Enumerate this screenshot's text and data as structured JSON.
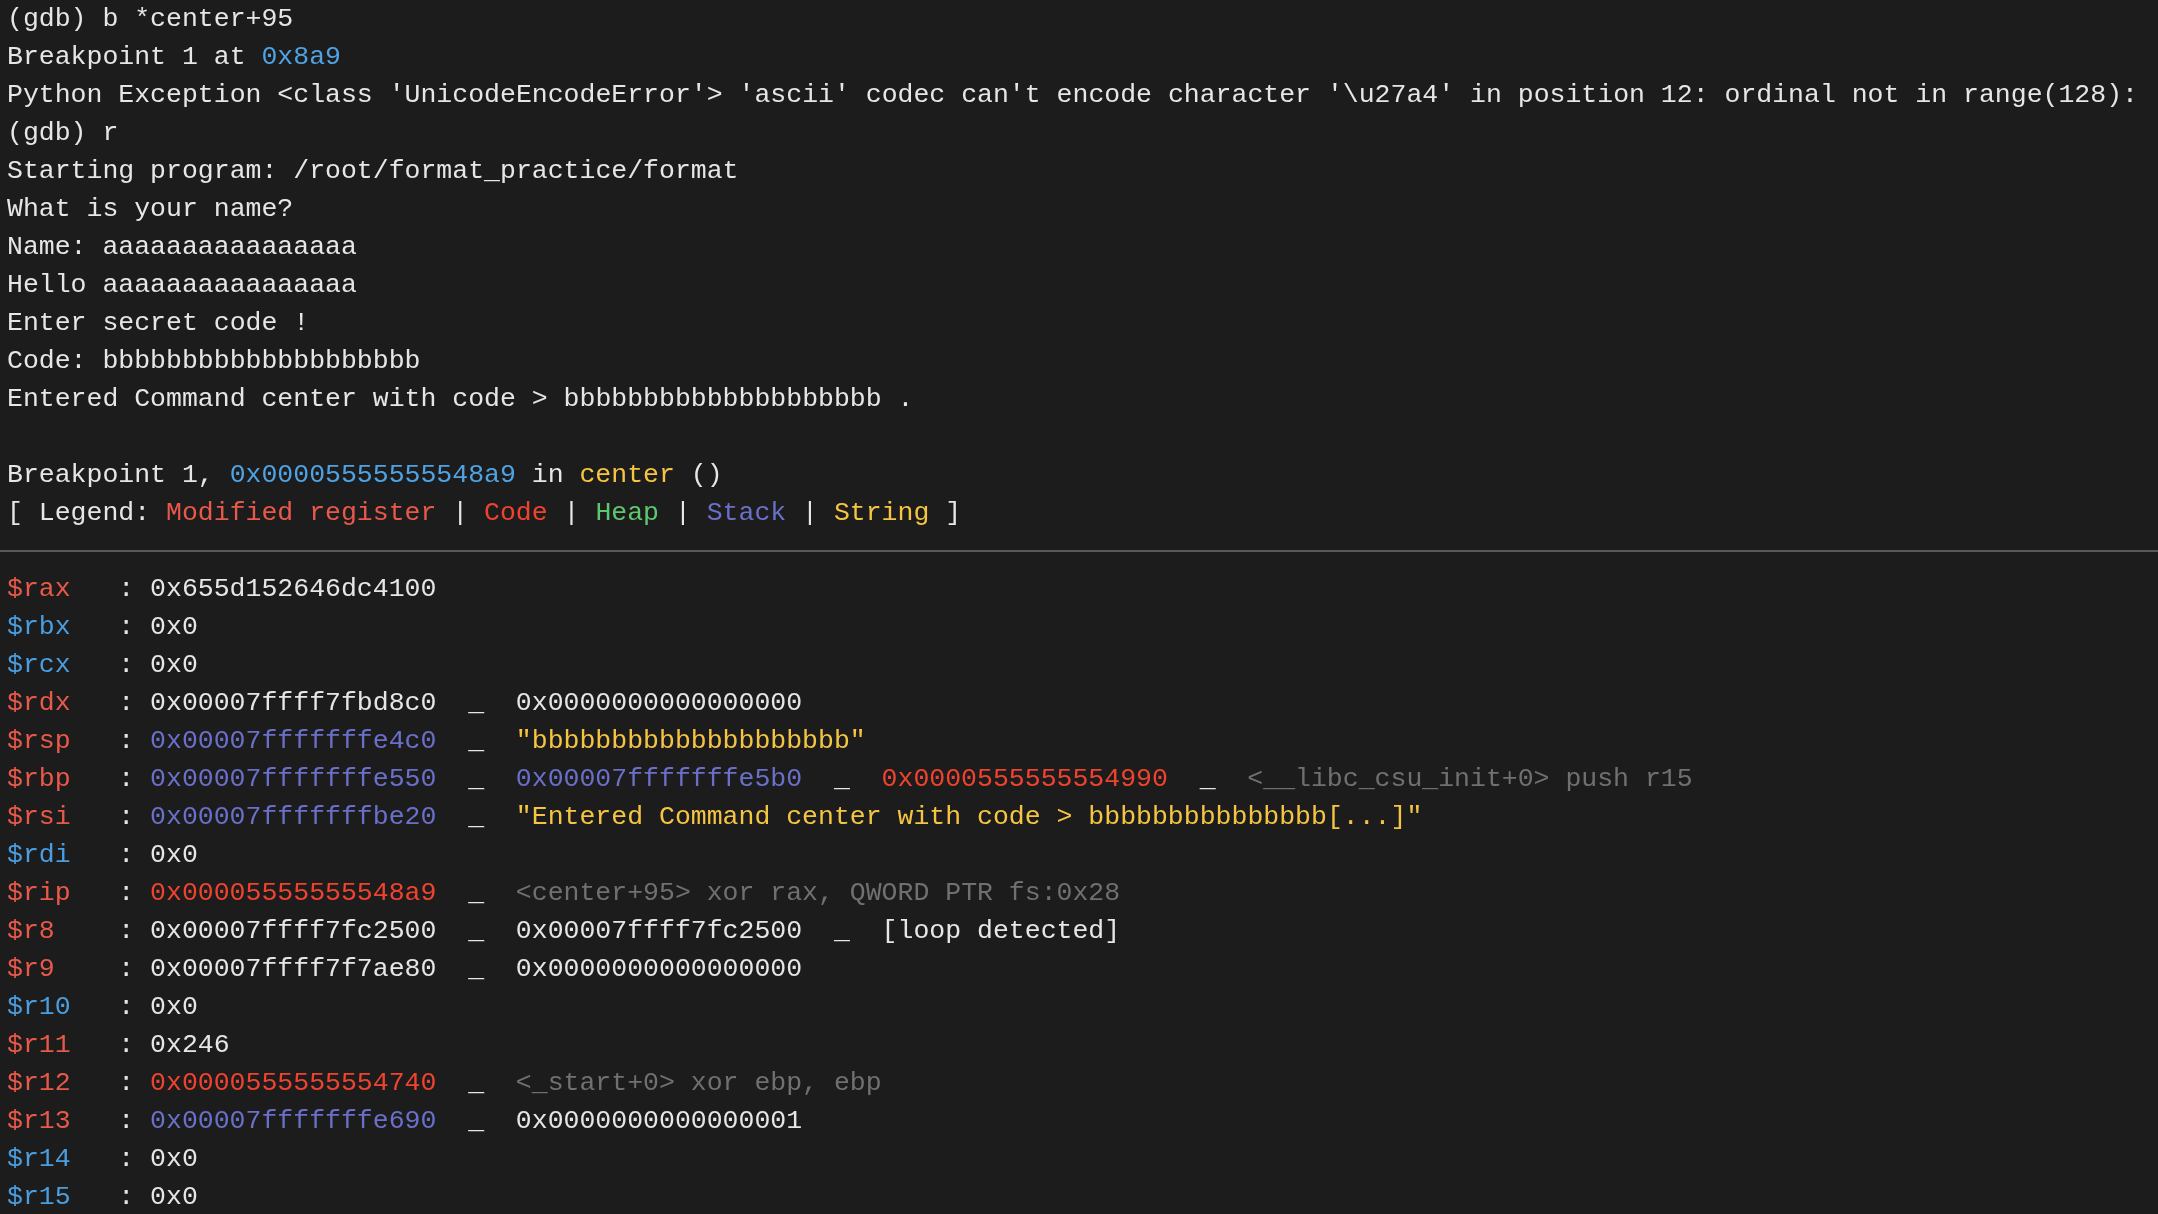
{
  "console": [
    [
      {
        "text": "(gdb) b *center+95",
        "kind": "plain"
      }
    ],
    [
      {
        "text": "Breakpoint 1 at",
        "kind": "plain"
      },
      {
        "text": "0x8a9",
        "kind": "address"
      }
    ],
    [
      {
        "text": "Python Exception <class 'UnicodeEncodeError'> 'ascii' codec can't encode character '\\u27a4' in position 12: ordinal not in range(128):",
        "kind": "plain"
      }
    ],
    [
      {
        "text": "(gdb) r",
        "kind": "plain"
      }
    ],
    [
      {
        "text": "Starting program: /root/format_practice/format",
        "kind": "plain"
      }
    ],
    [
      {
        "text": "What is your name?",
        "kind": "plain"
      }
    ],
    [
      {
        "text": "Name: aaaaaaaaaaaaaaaa",
        "kind": "plain"
      }
    ],
    [
      {
        "text": "Hello aaaaaaaaaaaaaaaa",
        "kind": "plain"
      }
    ],
    [
      {
        "text": "Enter secret code !",
        "kind": "plain"
      }
    ],
    [
      {
        "text": "Code: bbbbbbbbbbbbbbbbbbbb",
        "kind": "plain"
      }
    ],
    [
      {
        "text": "Entered Command center with code > bbbbbbbbbbbbbbbbbbbb .",
        "kind": "plain"
      }
    ]
  ],
  "breakpoint_report": [
    [
      {
        "text": "Breakpoint 1,",
        "kind": "plain"
      },
      {
        "text": "0x00005555555548a9",
        "kind": "address"
      },
      {
        "text": "in",
        "kind": "plain"
      },
      {
        "text": "center",
        "kind": "symbol"
      },
      {
        "text": "()",
        "kind": "plain"
      }
    ],
    [
      {
        "text": "[ Legend:",
        "kind": "plain"
      },
      {
        "text": "Modified register",
        "kind": "modified"
      },
      {
        "text": "|",
        "kind": "plain"
      },
      {
        "text": "Code",
        "kind": "code"
      },
      {
        "text": "|",
        "kind": "plain"
      },
      {
        "text": "Heap",
        "kind": "heap"
      },
      {
        "text": "|",
        "kind": "plain"
      },
      {
        "text": "Stack",
        "kind": "stack"
      },
      {
        "text": "|",
        "kind": "plain"
      },
      {
        "text": "String",
        "kind": "string"
      },
      {
        "text": "]",
        "kind": "plain"
      }
    ]
  ],
  "registers": [
    {
      "name": "$rax",
      "modified": true,
      "separator": ":",
      "chain": [
        {
          "text": "0x655d152646dc4100",
          "kind": "plain"
        }
      ]
    },
    {
      "name": "$rbx",
      "modified": false,
      "separator": ":",
      "chain": [
        {
          "text": "0x0",
          "kind": "plain"
        }
      ]
    },
    {
      "name": "$rcx",
      "modified": false,
      "separator": ":",
      "chain": [
        {
          "text": "0x0",
          "kind": "plain"
        }
      ]
    },
    {
      "name": "$rdx",
      "modified": true,
      "separator": ":",
      "chain": [
        {
          "text": "0x00007ffff7fbd8c0",
          "kind": "plain"
        },
        {
          "text": "_",
          "kind": "arrow"
        },
        {
          "text": "0x0000000000000000",
          "kind": "plain"
        }
      ]
    },
    {
      "name": "$rsp",
      "modified": true,
      "separator": ":",
      "chain": [
        {
          "text": "0x00007fffffffe4c0",
          "kind": "stack"
        },
        {
          "text": "_",
          "kind": "arrow"
        },
        {
          "text": "\"bbbbbbbbbbbbbbbbbbbb\"",
          "kind": "string"
        }
      ]
    },
    {
      "name": "$rbp",
      "modified": true,
      "separator": ":",
      "chain": [
        {
          "text": "0x00007fffffffe550",
          "kind": "stack"
        },
        {
          "text": "_",
          "kind": "arrow"
        },
        {
          "text": "0x00007fffffffe5b0",
          "kind": "stack"
        },
        {
          "text": "_",
          "kind": "arrow"
        },
        {
          "text": "0x0000555555554990",
          "kind": "code"
        },
        {
          "text": "_",
          "kind": "arrow"
        },
        {
          "text": "<__libc_csu_init+0> push r15",
          "kind": "comment"
        }
      ]
    },
    {
      "name": "$rsi",
      "modified": true,
      "separator": ":",
      "chain": [
        {
          "text": "0x00007fffffffbe20",
          "kind": "stack"
        },
        {
          "text": "_",
          "kind": "arrow"
        },
        {
          "text": "\"Entered Command center with code > bbbbbbbbbbbbbbb[...]\"",
          "kind": "string"
        }
      ]
    },
    {
      "name": "$rdi",
      "modified": false,
      "separator": ":",
      "chain": [
        {
          "text": "0x0",
          "kind": "plain"
        }
      ]
    },
    {
      "name": "$rip",
      "modified": true,
      "separator": ":",
      "chain": [
        {
          "text": "0x00005555555548a9",
          "kind": "code"
        },
        {
          "text": "_",
          "kind": "arrow"
        },
        {
          "text": "<center+95> xor rax, QWORD PTR fs:0x28",
          "kind": "comment"
        }
      ]
    },
    {
      "name": "$r8",
      "modified": true,
      "separator": ":",
      "chain": [
        {
          "text": "0x00007ffff7fc2500",
          "kind": "plain"
        },
        {
          "text": "_",
          "kind": "arrow"
        },
        {
          "text": "0x00007ffff7fc2500",
          "kind": "plain"
        },
        {
          "text": "_",
          "kind": "arrow"
        },
        {
          "text": "[loop detected]",
          "kind": "plain"
        }
      ]
    },
    {
      "name": "$r9",
      "modified": true,
      "separator": ":",
      "chain": [
        {
          "text": "0x00007ffff7f7ae80",
          "kind": "plain"
        },
        {
          "text": "_",
          "kind": "arrow"
        },
        {
          "text": "0x0000000000000000",
          "kind": "plain"
        }
      ]
    },
    {
      "name": "$r10",
      "modified": false,
      "separator": ":",
      "chain": [
        {
          "text": "0x0",
          "kind": "plain"
        }
      ]
    },
    {
      "name": "$r11",
      "modified": true,
      "separator": ":",
      "chain": [
        {
          "text": "0x246",
          "kind": "plain"
        }
      ]
    },
    {
      "name": "$r12",
      "modified": true,
      "separator": ":",
      "chain": [
        {
          "text": "0x0000555555554740",
          "kind": "code"
        },
        {
          "text": "_",
          "kind": "arrow"
        },
        {
          "text": "<_start+0> xor ebp, ebp",
          "kind": "comment"
        }
      ]
    },
    {
      "name": "$r13",
      "modified": true,
      "separator": ":",
      "chain": [
        {
          "text": "0x00007fffffffe690",
          "kind": "stack"
        },
        {
          "text": "_",
          "kind": "arrow"
        },
        {
          "text": "0x0000000000000001",
          "kind": "plain"
        }
      ]
    },
    {
      "name": "$r14",
      "modified": false,
      "separator": ":",
      "chain": [
        {
          "text": "0x0",
          "kind": "plain"
        }
      ]
    },
    {
      "name": "$r15",
      "modified": false,
      "separator": ":",
      "chain": [
        {
          "text": "0x0",
          "kind": "plain"
        }
      ]
    }
  ]
}
